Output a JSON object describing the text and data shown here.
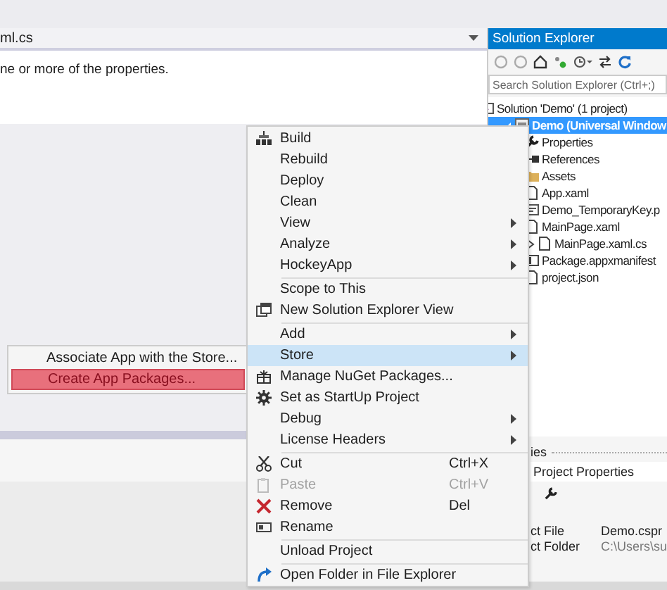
{
  "document": {
    "tab_title": "ml.cs",
    "message": "ne or more of the properties."
  },
  "solution_explorer": {
    "title": "Solution Explorer",
    "search": {
      "placeholder": "Search Solution Explorer (Ctrl+;)"
    },
    "tree": [
      {
        "label": "Solution 'Demo' (1 project)",
        "selected": false,
        "children": [
          {
            "label": "Demo (Universal Window",
            "selected": true,
            "expanded": true,
            "children": [
              {
                "label": "Properties",
                "selected": false
              },
              {
                "label": "References",
                "selected": false
              },
              {
                "label": "Assets",
                "selected": false
              },
              {
                "label": "App.xaml",
                "selected": false
              },
              {
                "label": "Demo_TemporaryKey.p",
                "selected": false
              },
              {
                "label": "MainPage.xaml",
                "selected": false
              },
              {
                "label": "MainPage.xaml.cs",
                "selected": false,
                "expanded": false
              },
              {
                "label": "Package.appxmanifest",
                "selected": false
              },
              {
                "label": "project.json",
                "selected": false
              }
            ]
          }
        ]
      }
    ]
  },
  "context_menu": {
    "items": [
      {
        "kind": "item",
        "label": "Build",
        "submenu": false,
        "disabled": false,
        "selected": false
      },
      {
        "kind": "item",
        "label": "Rebuild",
        "submenu": false,
        "disabled": false,
        "selected": false
      },
      {
        "kind": "item",
        "label": "Deploy",
        "submenu": false,
        "disabled": false,
        "selected": false
      },
      {
        "kind": "item",
        "label": "Clean",
        "submenu": false,
        "disabled": false,
        "selected": false
      },
      {
        "kind": "item",
        "label": "View",
        "submenu": true,
        "disabled": false,
        "selected": false
      },
      {
        "kind": "item",
        "label": "Analyze",
        "submenu": true,
        "disabled": false,
        "selected": false
      },
      {
        "kind": "item",
        "label": "HockeyApp",
        "submenu": true,
        "disabled": false,
        "selected": false
      },
      {
        "kind": "separator"
      },
      {
        "kind": "item",
        "label": "Scope to This",
        "submenu": false,
        "disabled": false,
        "selected": false
      },
      {
        "kind": "item",
        "label": "New Solution Explorer View",
        "submenu": false,
        "disabled": false,
        "selected": false
      },
      {
        "kind": "separator"
      },
      {
        "kind": "item",
        "label": "Add",
        "submenu": true,
        "disabled": false,
        "selected": false
      },
      {
        "kind": "item",
        "label": "Store",
        "submenu": true,
        "disabled": false,
        "selected": true
      },
      {
        "kind": "item",
        "label": "Manage NuGet Packages...",
        "submenu": false,
        "disabled": false,
        "selected": false
      },
      {
        "kind": "item",
        "label": "Set as StartUp Project",
        "submenu": false,
        "disabled": false,
        "selected": false
      },
      {
        "kind": "item",
        "label": "Debug",
        "submenu": true,
        "disabled": false,
        "selected": false
      },
      {
        "kind": "item",
        "label": "License Headers",
        "submenu": true,
        "disabled": false,
        "selected": false
      },
      {
        "kind": "separator"
      },
      {
        "kind": "item",
        "label": "Cut",
        "shortcut": "Ctrl+X",
        "submenu": false,
        "disabled": false,
        "selected": false
      },
      {
        "kind": "item",
        "label": "Paste",
        "shortcut": "Ctrl+V",
        "submenu": false,
        "disabled": true,
        "selected": false
      },
      {
        "kind": "item",
        "label": "Remove",
        "shortcut": "Del",
        "submenu": false,
        "disabled": false,
        "selected": false
      },
      {
        "kind": "item",
        "label": "Rename",
        "submenu": false,
        "disabled": false,
        "selected": false
      },
      {
        "kind": "separator"
      },
      {
        "kind": "item",
        "label": "Unload Project",
        "submenu": false,
        "disabled": false,
        "selected": false
      },
      {
        "kind": "separator"
      },
      {
        "kind": "item",
        "label": "Open Folder in File Explorer",
        "submenu": false,
        "disabled": false,
        "selected": false
      }
    ]
  },
  "submenu": {
    "items": [
      {
        "label": "Associate App with the Store...",
        "selected": false
      },
      {
        "label": "Create App Packages...",
        "selected": true
      }
    ]
  },
  "properties": {
    "title": "ies",
    "object": "Project Properties",
    "rows": [
      {
        "name": "ct File",
        "value": "Demo.cspr"
      },
      {
        "name": "ct Folder",
        "value": "C:\\Users\\su"
      }
    ]
  }
}
